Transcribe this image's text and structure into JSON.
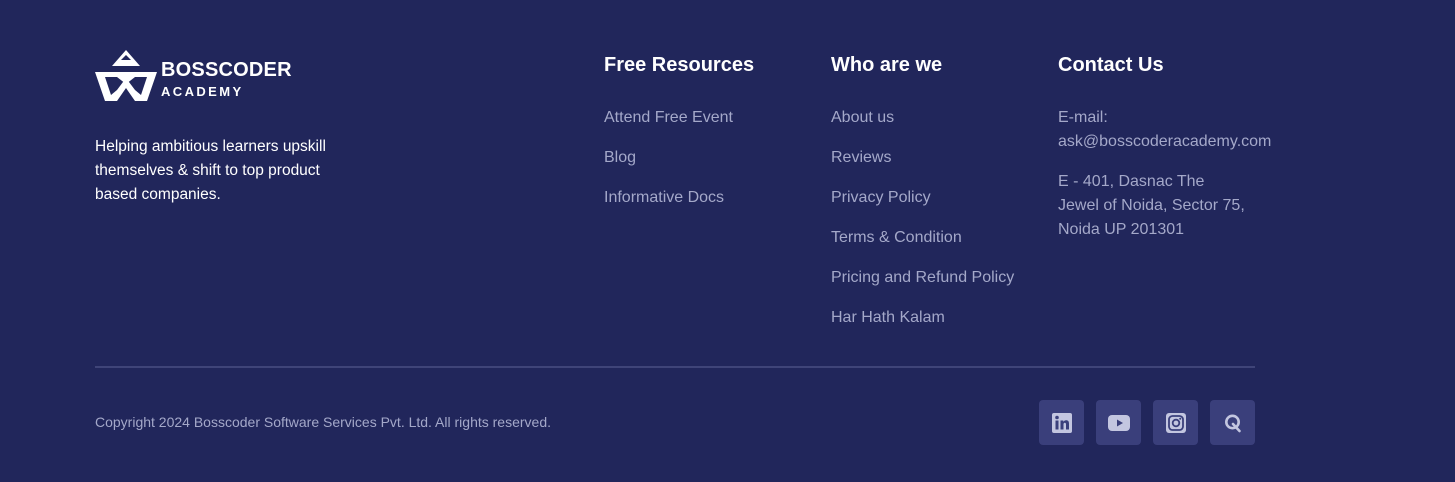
{
  "brand": {
    "name": "BOSSCODER",
    "sub": "ACADEMY",
    "tagline": "Helping ambitious learners upskill themselves & shift to top product based companies."
  },
  "columns": {
    "resources": {
      "title": "Free Resources",
      "links": [
        "Attend Free Event",
        "Blog",
        "Informative Docs"
      ]
    },
    "who": {
      "title": "Who are we",
      "links": [
        "About us",
        "Reviews",
        "Privacy Policy",
        "Terms & Condition",
        "Pricing and Refund Policy",
        "Har Hath Kalam"
      ]
    },
    "contact": {
      "title": "Contact Us",
      "email_label": "E-mail:",
      "email": "ask@bosscoderacademy.com",
      "address": "E - 401, Dasnac The Jewel of Noida, Sector 75, Noida UP 201301"
    }
  },
  "bottom": {
    "copyright": "Copyright 2024 Bosscoder Software Services Pvt. Ltd. All rights reserved.",
    "socials": [
      {
        "icon": "linkedin-icon"
      },
      {
        "icon": "youtube-icon"
      },
      {
        "icon": "instagram-icon"
      },
      {
        "icon": "quora-icon"
      }
    ]
  },
  "colors": {
    "background": "#21265b",
    "link": "#a4a8c9",
    "social_bg": "#3a3f7b",
    "icon": "#c3c6e0"
  }
}
